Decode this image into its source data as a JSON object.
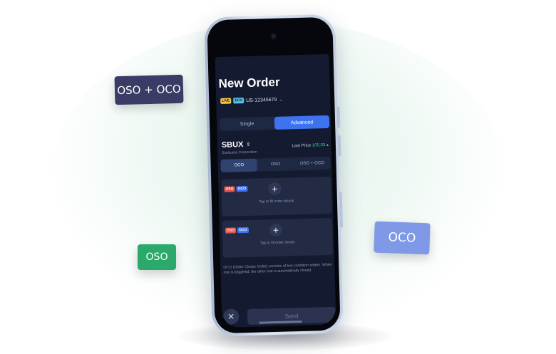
{
  "tags": {
    "oso_oco": "OSO + OCO",
    "oso": "OSO",
    "oco": "OCO"
  },
  "screen": {
    "title": "New Order",
    "account": {
      "live_badge": "LIVE",
      "eco_badge": "ECO",
      "number": "US-12345679"
    },
    "mode_tabs": [
      "Single",
      "Advanced"
    ],
    "selected_mode": "Advanced",
    "symbol": {
      "ticker": "SBUX",
      "name": "Starbucks Corporation",
      "last_price_label": "Last Price",
      "last_price_value": "105.03"
    },
    "order_types": [
      "OCO",
      "OSO",
      "OSO + OCO"
    ],
    "selected_order_type": "OCO",
    "cards": [
      {
        "badge1": "OSO",
        "badge2": "OCO",
        "hint": "Tap to fill order details"
      },
      {
        "badge1": "OSO",
        "badge2": "OCO",
        "hint": "Tap to fill order details"
      }
    ],
    "description": "OCO (Order Closes Order) consists of two condition orders. When one is triggered, the other one is automatically closed.",
    "send_label": "Send"
  },
  "colors": {
    "accent": "#3e73f0",
    "positive": "#35d39a",
    "oso_tag": "#2aa96a",
    "oco_tag": "#7f99e6",
    "oso_oco_tag": "#3a3c66"
  },
  "icons": [
    "close-icon",
    "plus-icon",
    "up-down-arrows-icon",
    "chevron-down-icon",
    "camera-icon"
  ]
}
